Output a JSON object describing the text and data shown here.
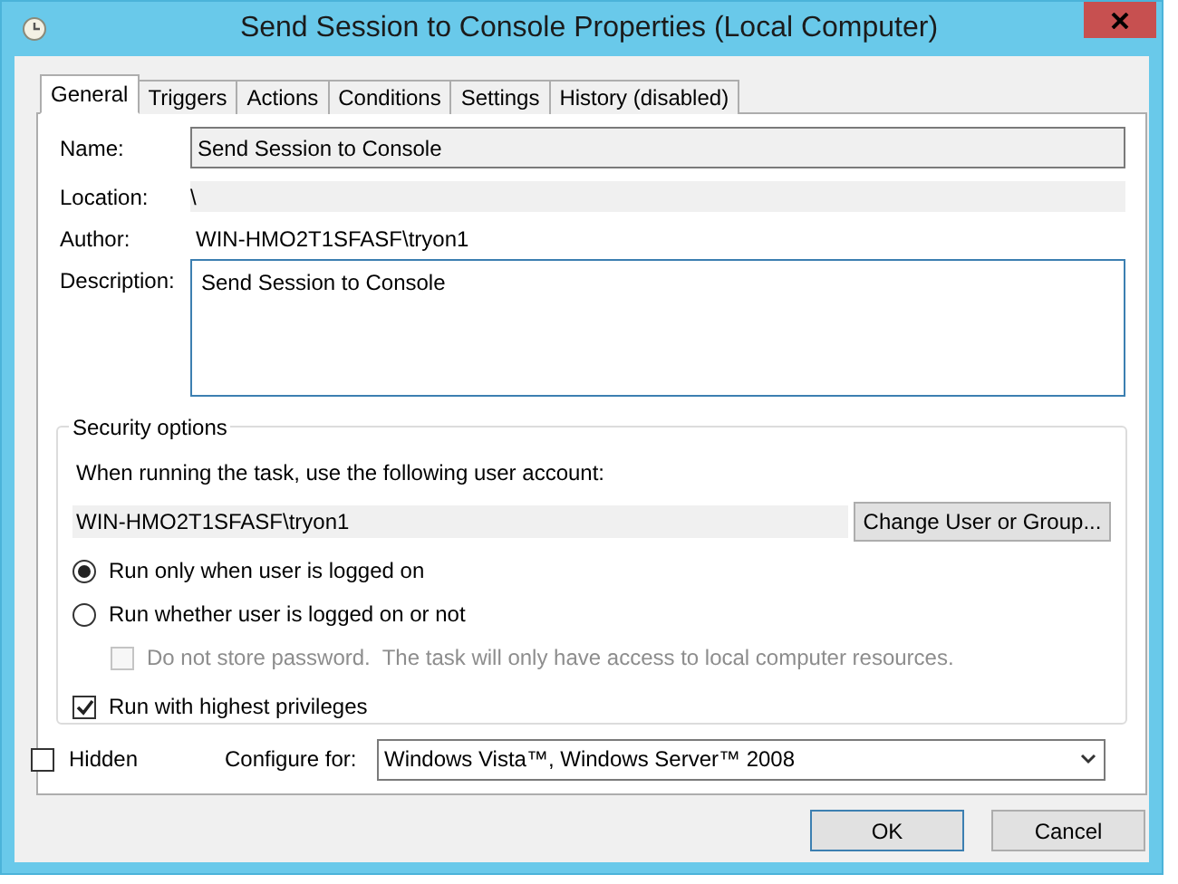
{
  "window": {
    "title": "Send Session to Console Properties (Local Computer)"
  },
  "tabs": [
    {
      "label": "General",
      "selected": true
    },
    {
      "label": "Triggers",
      "selected": false
    },
    {
      "label": "Actions",
      "selected": false
    },
    {
      "label": "Conditions",
      "selected": false
    },
    {
      "label": "Settings",
      "selected": false
    },
    {
      "label": "History (disabled)",
      "selected": false
    }
  ],
  "general": {
    "name": {
      "label": "Name:",
      "value": "Send Session to Console"
    },
    "location": {
      "label": "Location:",
      "value": "\\"
    },
    "author": {
      "label": "Author:",
      "value": "WIN-HMO2T1SFASF\\tryon1"
    },
    "description": {
      "label": "Description:",
      "value": "Send Session to Console"
    }
  },
  "security": {
    "title": "Security options",
    "prompt": "When running the task, use the following user account:",
    "account": "WIN-HMO2T1SFASF\\tryon1",
    "change_button": "Change User or Group...",
    "options": [
      {
        "kind": "radio",
        "label": "Run only when user is logged on",
        "selected": true,
        "disabled": false
      },
      {
        "kind": "radio",
        "label": "Run whether user is logged on or not",
        "selected": false,
        "disabled": false,
        "children": [
          {
            "kind": "checkbox",
            "label": "Do not store password.  The task will only have access to local computer resources.",
            "checked": false,
            "disabled": true
          }
        ]
      },
      {
        "kind": "checkbox",
        "label": "Run with highest privileges",
        "checked": true,
        "disabled": false
      }
    ]
  },
  "hidden": {
    "label": "Hidden",
    "checked": false
  },
  "configure": {
    "label": "Configure for:",
    "value": "Windows Vista™, Windows Server™ 2008"
  },
  "buttons": [
    {
      "label": "OK",
      "default": true
    },
    {
      "label": "Cancel",
      "default": false
    }
  ]
}
